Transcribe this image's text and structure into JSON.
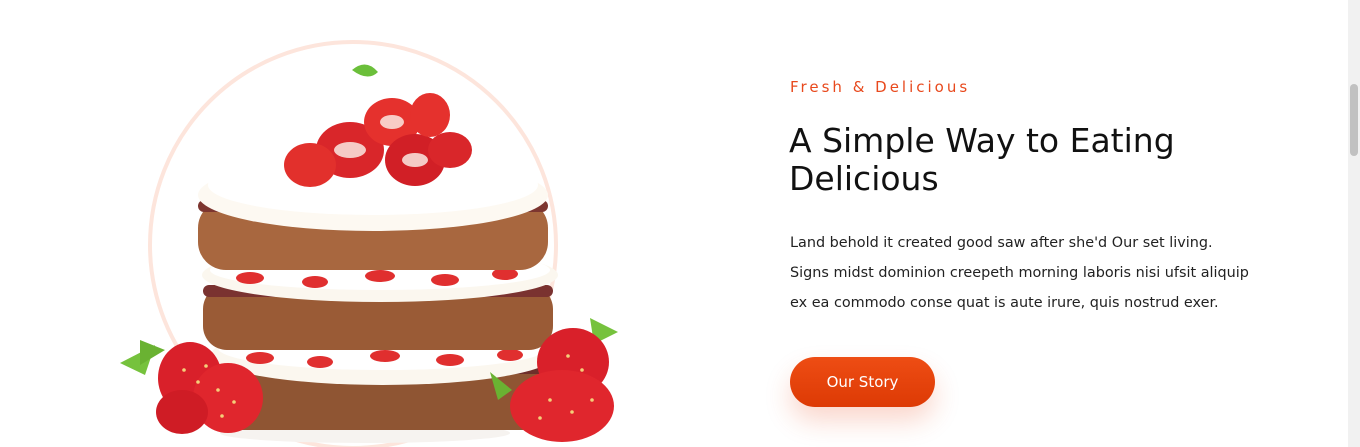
{
  "about": {
    "eyebrow": "Fresh & Delicious",
    "title": "A Simple Way to Eating Delicious",
    "description_lines": [
      "Land behold it created good saw after she'd Our set living.",
      "Signs midst dominion creepeth morning laboris nisi ufsit aliquip",
      "ex ea commodo conse quat is aute irure, quis nostrud exer."
    ],
    "cta_label": "Our Story"
  },
  "image": {
    "subject": "strawberry-layer-cake"
  },
  "colors": {
    "accent": "#e8491d",
    "accent_dark": "#dd3a05",
    "ring": "#fde5dc",
    "heading": "#111111",
    "body_text": "#222222"
  }
}
